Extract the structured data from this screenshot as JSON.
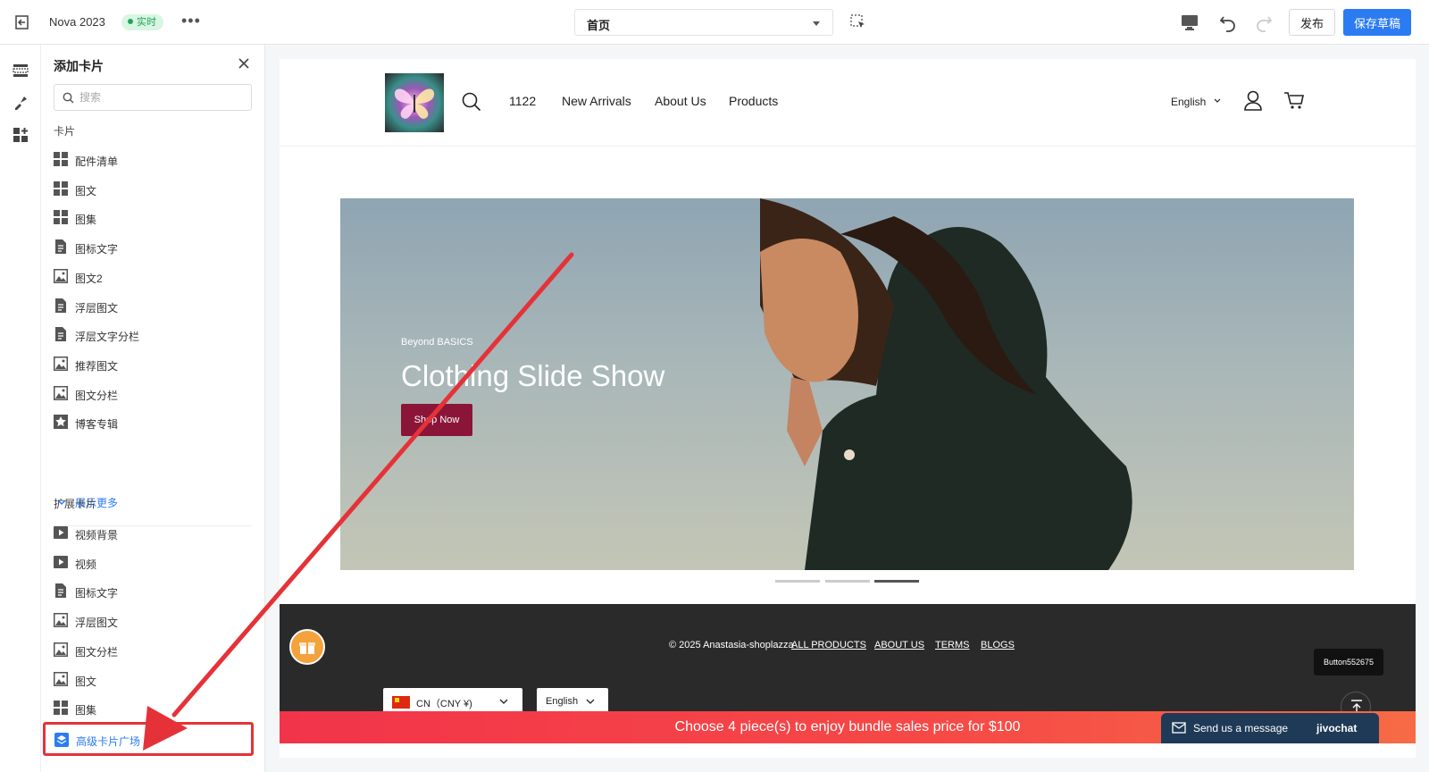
{
  "topbar": {
    "theme_name": "Nova 2023",
    "live_badge": "实时",
    "page_select": "首页",
    "publish_label": "发布",
    "save_draft_label": "保存草稿"
  },
  "panel": {
    "title": "添加卡片",
    "search_placeholder": "搜索",
    "cards_section": "卡片",
    "cards": [
      {
        "label": "配件清单",
        "icon": "grid-icon"
      },
      {
        "label": "图文",
        "icon": "grid-icon"
      },
      {
        "label": "图集",
        "icon": "grid-icon"
      },
      {
        "label": "图标文字",
        "icon": "document-icon"
      },
      {
        "label": "图文2",
        "icon": "image-icon"
      },
      {
        "label": "浮层图文",
        "icon": "document-icon"
      },
      {
        "label": "浮层文字分栏",
        "icon": "document-icon"
      },
      {
        "label": "推荐图文",
        "icon": "image-icon"
      },
      {
        "label": "图文分栏",
        "icon": "image-icon"
      },
      {
        "label": "博客专辑",
        "icon": "star-icon"
      }
    ],
    "show_more": "展示更多",
    "extended_section": "扩展卡片",
    "extended": [
      {
        "label": "视频背景",
        "icon": "video-icon"
      },
      {
        "label": "视频",
        "icon": "video-icon"
      },
      {
        "label": "图标文字",
        "icon": "document-icon"
      },
      {
        "label": "浮层图文",
        "icon": "image-icon"
      },
      {
        "label": "图文分栏",
        "icon": "image-icon"
      },
      {
        "label": "图文",
        "icon": "image-icon"
      },
      {
        "label": "图集",
        "icon": "grid-icon"
      }
    ],
    "advanced_label": "高级卡片广场"
  },
  "site": {
    "nav": [
      "1122",
      "New Arrivals",
      "About Us",
      "Products"
    ],
    "language": "English",
    "hero": {
      "kicker": "Beyond BASICS",
      "title": "Clothing Slide Show",
      "button": "Shop Now",
      "slides": 3,
      "active_slide": 3
    },
    "footer": {
      "copyright": "© 2025 Anastasia-shoplazza",
      "links": [
        "ALL PRODUCTS",
        "ABOUT US",
        "TERMS",
        "BLOGS"
      ],
      "currency": "CN（CNY ¥)",
      "language": "English"
    },
    "tooltip": "Button552675",
    "bundle_text": "Choose 4 piece(s) to enjoy bundle sales price for $100",
    "chat": {
      "message": "Send us a message",
      "brand": "jivochat"
    }
  },
  "colors": {
    "primary": "#2b7bf2",
    "live": "#23a55a",
    "hero_button": "#8b1538",
    "bundle_bar": "#f2344a",
    "annotation": "#e53238"
  }
}
